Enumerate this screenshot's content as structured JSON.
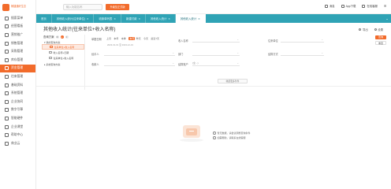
{
  "app": {
    "logo_text": "畅捷通好生意",
    "brand_color": "#f26b2b",
    "tab_color": "#2fa3b5"
  },
  "sidebar": {
    "items": [
      {
        "label": "搜索菜单",
        "icon": "search-icon"
      },
      {
        "label": "经营看板",
        "icon": "dashboard-icon"
      },
      {
        "label": "营销推广",
        "icon": "megaphone-icon"
      },
      {
        "label": "销售管理",
        "icon": "sales-icon"
      },
      {
        "label": "采购管理",
        "icon": "purchase-icon"
      },
      {
        "label": "库存管理",
        "icon": "inventory-icon"
      },
      {
        "label": "资金管理",
        "icon": "money-icon"
      },
      {
        "label": "往来管理",
        "icon": "contacts-icon"
      },
      {
        "label": "基础资料",
        "icon": "database-icon"
      },
      {
        "label": "系统管理",
        "icon": "gear-icon"
      },
      {
        "label": "企业协同",
        "icon": "collab-icon"
      },
      {
        "label": "数字引擎",
        "icon": "engine-icon"
      },
      {
        "label": "智能硬件",
        "icon": "hardware-icon"
      },
      {
        "label": "企业课堂",
        "icon": "classroom-icon"
      },
      {
        "label": "帮助中心",
        "icon": "help-icon"
      },
      {
        "label": "商业云",
        "icon": "cloud-icon"
      }
    ],
    "active_index": 6
  },
  "topbar": {
    "search_placeholder": "输入功能名称",
    "upgrade_label": "升级至正式版",
    "right": [
      {
        "label": "消息",
        "icon": "mail-icon"
      },
      {
        "label": "App下载",
        "icon": "phone-icon"
      },
      {
        "label": "在线客服",
        "icon": "headset-icon"
      }
    ]
  },
  "tabs": [
    {
      "label": "首页"
    },
    {
      "label": "其他收入统计(往来单位)"
    },
    {
      "label": "收款单列表"
    },
    {
      "label": "新建付款"
    },
    {
      "label": "其他收入统计"
    },
    {
      "label": "其他收入统计"
    }
  ],
  "active_tab": 5,
  "page": {
    "title": "其他收入统计(往来单位+收入名称)",
    "actions": [
      {
        "label": "导出",
        "icon": "export-icon"
      },
      {
        "label": "设置",
        "icon": "settings-icon"
      }
    ]
  },
  "scheme": {
    "title": "查询方案",
    "group_label": "我的查询方案",
    "items": [
      {
        "label": "往来单位+收入名称",
        "selected": true
      },
      {
        "label": "收入名称+日期",
        "selected": false
      },
      {
        "label": "往来单位+收入名称",
        "selected": false
      }
    ],
    "group2_label": "系统查询方案"
  },
  "filters": {
    "date_label": "单据日期",
    "date_options": [
      "上月",
      "本年",
      "本季",
      "本月",
      "昨天",
      "今天",
      "最近7天"
    ],
    "date_active_index": 3,
    "date_range": "2023-01-01 至 2023-12-31",
    "income_label": "收入名称",
    "contact_label": "往来单位",
    "dept_label": "部门",
    "handler_label": "经手人",
    "settle_label": "结算方式",
    "account_label": "结算账户",
    "account_value": "(全...)",
    "receiver_label": "收款人",
    "query_label": "查询",
    "reset_label": "重置",
    "collapse_label": "收起更多条件"
  },
  "empty_state": {
    "tips": [
      "暂无数据，请尝试调整查询条件",
      "如需帮助，请联系在线客服"
    ]
  }
}
